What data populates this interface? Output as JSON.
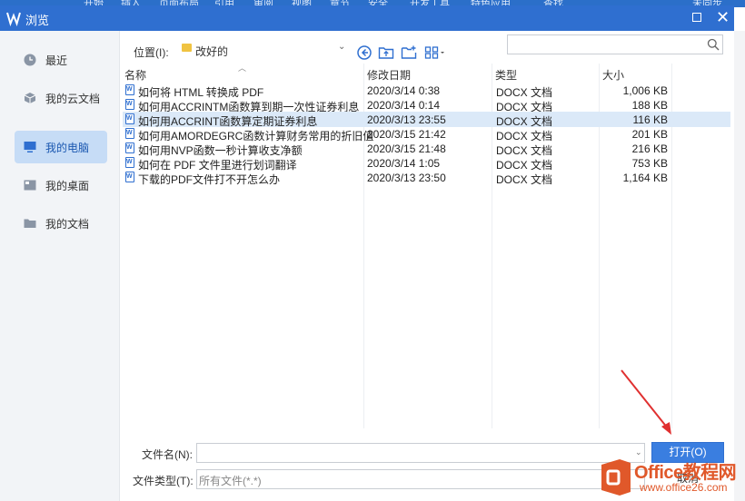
{
  "dialog": {
    "title": "浏览",
    "accent": "#2f6fd0"
  },
  "background_ribbon": [
    "开始",
    "插入",
    "页面布局",
    "引用",
    "审阅",
    "视图",
    "章节",
    "安全",
    "开发工具",
    "特色应用",
    "查找",
    "未同步"
  ],
  "sidebar": {
    "items": [
      {
        "label": "最近",
        "icon": "clock-icon",
        "active": false
      },
      {
        "label": "我的云文档",
        "icon": "cloud-cube-icon",
        "active": false
      },
      {
        "label": "我的电脑",
        "icon": "monitor-icon",
        "active": true
      },
      {
        "label": "我的桌面",
        "icon": "desktop-icon",
        "active": false
      },
      {
        "label": "我的文档",
        "icon": "folder-icon",
        "active": false
      }
    ]
  },
  "location": {
    "label": "位置(I):",
    "value": "改好的"
  },
  "search": {
    "placeholder": ""
  },
  "columns": {
    "name": "名称",
    "date": "修改日期",
    "type": "类型",
    "size": "大小"
  },
  "files": [
    {
      "name": "如何将 HTML 转换成 PDF",
      "date": "2020/3/14 0:38",
      "type": "DOCX 文档",
      "size": "1,006 KB",
      "selected": false
    },
    {
      "name": "如何用ACCRINTM函数算到期一次性证券利息",
      "date": "2020/3/14 0:14",
      "type": "DOCX 文档",
      "size": "188 KB",
      "selected": false
    },
    {
      "name": "如何用ACCRINT函数算定期证券利息",
      "date": "2020/3/13 23:55",
      "type": "DOCX 文档",
      "size": "116 KB",
      "selected": true
    },
    {
      "name": "如何用AMORDEGRC函数计算财务常用的折旧值",
      "date": "2020/3/15 21:42",
      "type": "DOCX 文档",
      "size": "201 KB",
      "selected": false
    },
    {
      "name": "如何用NVP函数一秒计算收支净额",
      "date": "2020/3/15 21:48",
      "type": "DOCX 文档",
      "size": "216 KB",
      "selected": false
    },
    {
      "name": "如何在 PDF 文件里进行划词翻译",
      "date": "2020/3/14 1:05",
      "type": "DOCX 文档",
      "size": "753 KB",
      "selected": false
    },
    {
      "name": "下载的PDF文件打不开怎么办",
      "date": "2020/3/13 23:50",
      "type": "DOCX 文档",
      "size": "1,164 KB",
      "selected": false
    }
  ],
  "bottom": {
    "filename_label": "文件名(N):",
    "filename_value": "",
    "filetype_label": "文件类型(T):",
    "filetype_value": "所有文件(*.*)",
    "open_label": "打开(O)",
    "cancel_label": "取消"
  },
  "watermark": {
    "line1": "Office教程网",
    "line2": "www.office26.com"
  }
}
